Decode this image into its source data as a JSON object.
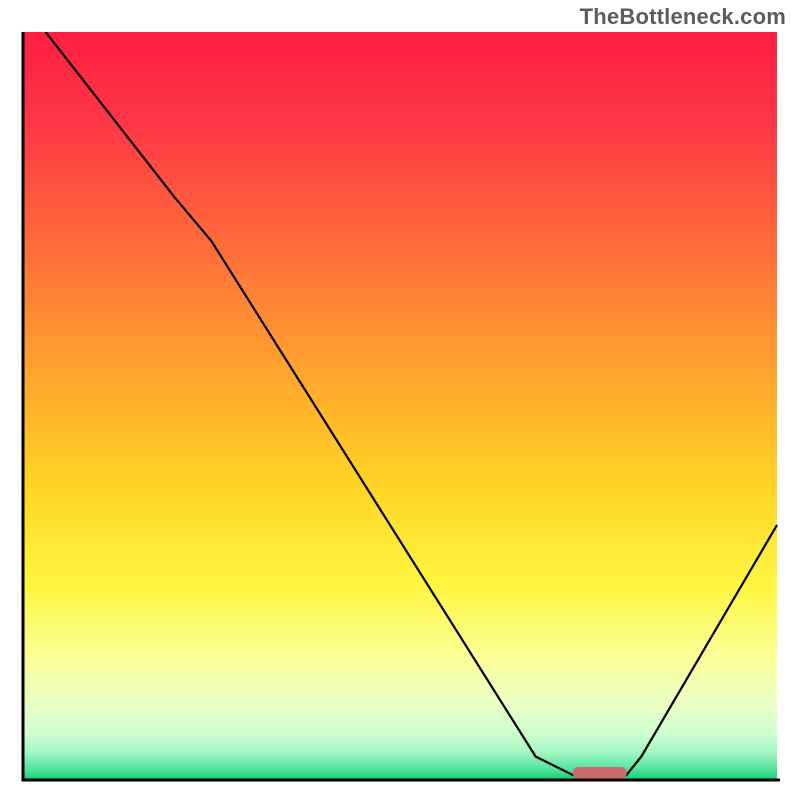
{
  "watermark": "TheBottleneck.com",
  "chart_data": {
    "type": "line",
    "title": "",
    "xlabel": "",
    "ylabel": "",
    "xlim": [
      0,
      100
    ],
    "ylim": [
      0,
      100
    ],
    "grid": false,
    "legend": false,
    "series": [
      {
        "name": "curve",
        "x": [
          3,
          20,
          25,
          68,
          73,
          80,
          82,
          100
        ],
        "y": [
          100,
          78,
          72,
          3,
          0.5,
          0.5,
          3,
          34
        ]
      }
    ],
    "highlight_band": {
      "x_start": 73,
      "x_end": 80,
      "y": 0.8,
      "color": "#cb6a6d"
    },
    "background_gradient": {
      "stops": [
        {
          "offset": 0.0,
          "color": "#ff1f42"
        },
        {
          "offset": 0.12,
          "color": "#ff3646"
        },
        {
          "offset": 0.28,
          "color": "#ff6a3a"
        },
        {
          "offset": 0.45,
          "color": "#ffa22e"
        },
        {
          "offset": 0.6,
          "color": "#ffd224"
        },
        {
          "offset": 0.74,
          "color": "#fff640"
        },
        {
          "offset": 0.84,
          "color": "#fbff9a"
        },
        {
          "offset": 0.9,
          "color": "#e9ffc6"
        },
        {
          "offset": 0.94,
          "color": "#ccffce"
        },
        {
          "offset": 0.965,
          "color": "#a1f5c2"
        },
        {
          "offset": 0.985,
          "color": "#58e6a0"
        },
        {
          "offset": 1.0,
          "color": "#17d07a"
        }
      ]
    }
  }
}
